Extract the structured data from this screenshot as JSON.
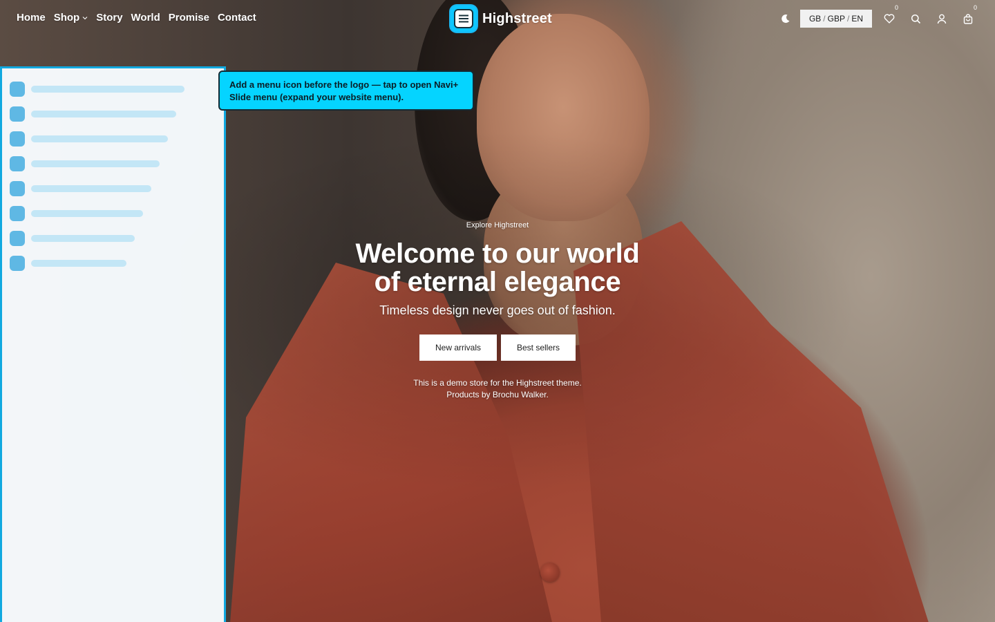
{
  "nav": {
    "items": [
      {
        "label": "Home"
      },
      {
        "label": "Shop",
        "has_dropdown": true
      },
      {
        "label": "Story"
      },
      {
        "label": "World"
      },
      {
        "label": "Promise"
      },
      {
        "label": "Contact"
      }
    ]
  },
  "logo": {
    "text": "Highstreet",
    "menu_icon": "hamburger-menu-icon",
    "accent_color": "#0dc7ff"
  },
  "header_right": {
    "theme_icon": "moon-icon",
    "locale": {
      "country": "GB",
      "currency": "GBP",
      "language": "EN",
      "separator": "/"
    },
    "wishlist": {
      "icon": "heart-icon",
      "count": "0"
    },
    "search_icon": "search-icon",
    "account_icon": "user-icon",
    "cart": {
      "icon": "shopping-bag-icon",
      "count": "0"
    }
  },
  "callout": {
    "text": "Add a menu icon before the logo — tap to open Navi+ Slide menu (expand your website menu).",
    "background": "#05d4ff"
  },
  "slide_menu": {
    "item_count": 8,
    "border_color": "#11a9e0"
  },
  "hero": {
    "eyebrow": "Explore Highstreet",
    "title_line1": "Welcome to our world",
    "title_line2": "of eternal elegance",
    "subtitle": "Timeless design never goes out of fashion.",
    "cta_primary": "New arrivals",
    "cta_secondary": "Best sellers",
    "note_line1": "This is a demo store for the Highstreet theme.",
    "note_line2": "Products by Brochu Walker."
  }
}
